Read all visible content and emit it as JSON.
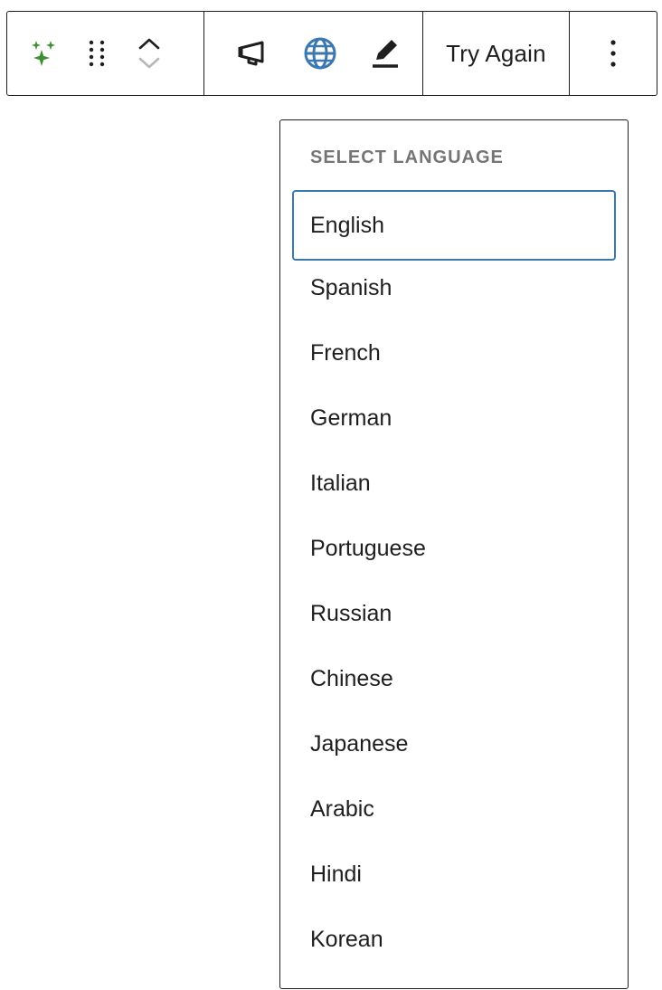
{
  "toolbar": {
    "ai_icon": "sparkles-icon",
    "drag_icon": "drag-handle-icon",
    "move_up_icon": "chevron-up-icon",
    "move_down_icon": "chevron-down-icon",
    "tone_icon": "megaphone-icon",
    "translate_icon": "globe-icon",
    "edit_icon": "pencil-icon",
    "try_again_label": "Try Again",
    "more_icon": "vertical-ellipsis-icon"
  },
  "language_menu": {
    "heading": "SELECT LANGUAGE",
    "focused_index": 0,
    "languages": [
      {
        "label": "English"
      },
      {
        "label": "Spanish"
      },
      {
        "label": "French"
      },
      {
        "label": "German"
      },
      {
        "label": "Italian"
      },
      {
        "label": "Portuguese"
      },
      {
        "label": "Russian"
      },
      {
        "label": "Chinese"
      },
      {
        "label": "Japanese"
      },
      {
        "label": "Arabic"
      },
      {
        "label": "Hindi"
      },
      {
        "label": "Korean"
      }
    ]
  },
  "colors": {
    "accent": "#3c78b0",
    "ai_green": "#3f8f34",
    "text": "#1e1e1e",
    "muted": "#757575",
    "disabled": "#b8b8b8"
  }
}
